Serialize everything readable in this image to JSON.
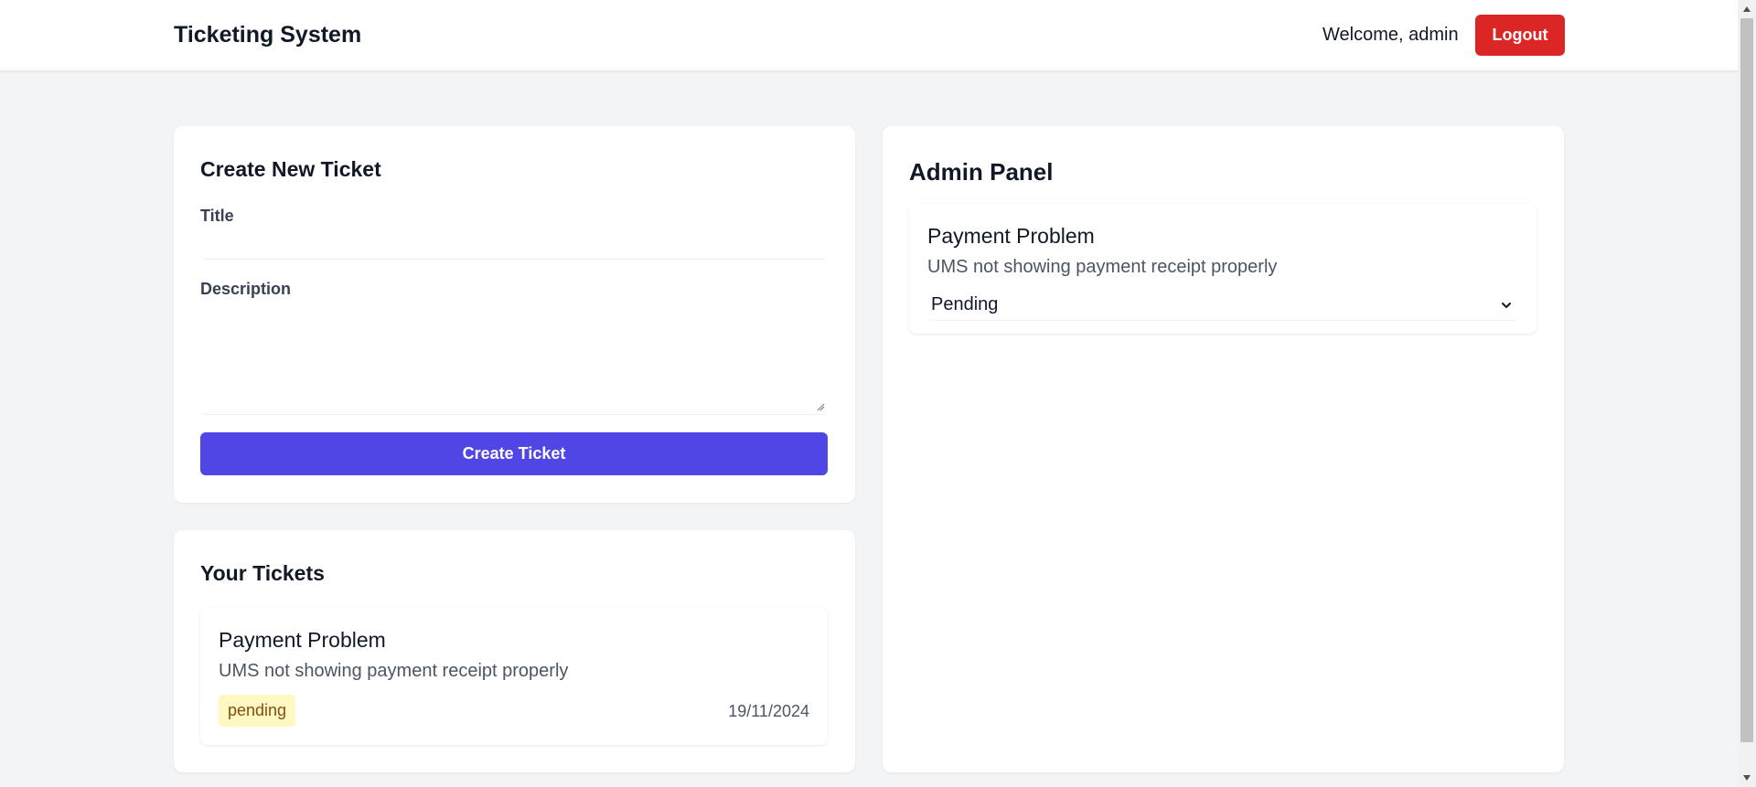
{
  "header": {
    "brand": "Ticketing System",
    "welcome": "Welcome, admin",
    "logout_label": "Logout"
  },
  "create_ticket": {
    "heading": "Create New Ticket",
    "title_label": "Title",
    "title_value": "",
    "title_placeholder": "",
    "description_label": "Description",
    "description_value": "",
    "submit_label": "Create Ticket"
  },
  "your_tickets": {
    "heading": "Your Tickets",
    "items": [
      {
        "title": "Payment Problem",
        "description": "UMS not showing payment receipt properly",
        "status": "pending",
        "date": "19/11/2024"
      }
    ]
  },
  "admin_panel": {
    "heading": "Admin Panel",
    "items": [
      {
        "title": "Payment Problem",
        "description": "UMS not showing payment receipt properly",
        "status_selected": "Pending"
      }
    ]
  },
  "colors": {
    "accent": "#4f46e5",
    "danger": "#dc2626",
    "badge_bg": "#fef9c3",
    "badge_text": "#854d0e",
    "page_bg": "#f3f4f6"
  }
}
